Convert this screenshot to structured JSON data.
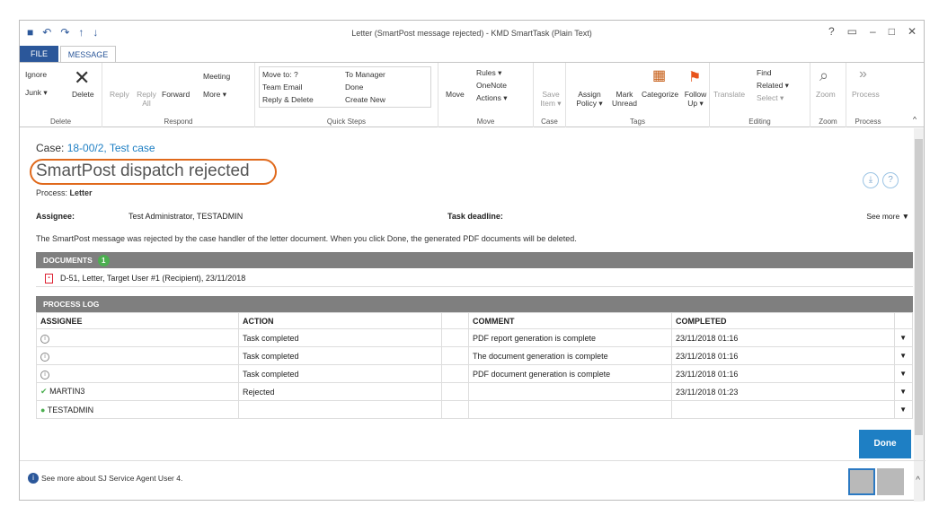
{
  "window": {
    "title": "Letter (SmartPost message rejected) - KMD SmartTask (Plain Text)",
    "controls": [
      "?",
      "▭",
      "–",
      "□",
      "✕"
    ]
  },
  "tabs": {
    "file": "FILE",
    "message": "MESSAGE"
  },
  "ribbon": {
    "delete": {
      "label": "Delete",
      "ignore": "Ignore",
      "junk": "Junk ▾",
      "delete_btn": "Delete"
    },
    "respond": {
      "label": "Respond",
      "reply": "Reply",
      "reply_all": "Reply All",
      "forward": "Forward",
      "meeting": "Meeting",
      "more": "More ▾"
    },
    "quick_steps": {
      "label": "Quick Steps",
      "move_to": "Move to: ?",
      "team_email": "Team Email",
      "reply_delete": "Reply & Delete",
      "to_manager": "To Manager",
      "done": "Done",
      "create_new": "Create New"
    },
    "move": {
      "label": "Move",
      "move_btn": "Move",
      "rules": "Rules ▾",
      "onenote": "OneNote",
      "actions": "Actions ▾"
    },
    "case": {
      "label": "Case",
      "save_item": "Save Item ▾"
    },
    "tags": {
      "label": "Tags",
      "assign_policy": "Assign Policy ▾",
      "mark_unread": "Mark Unread",
      "categorize": "Categorize",
      "follow_up": "Follow Up ▾"
    },
    "editing": {
      "label": "Editing",
      "translate": "Translate",
      "find": "Find",
      "related": "Related ▾",
      "select": "Select ▾"
    },
    "zoom": {
      "label": "Zoom",
      "zoom_btn": "Zoom"
    },
    "process": {
      "label": "Process",
      "process_btn": "Process"
    }
  },
  "case": {
    "prefix": "Case:",
    "id": "18-00/2, Test case"
  },
  "heading": "SmartPost dispatch rejected",
  "process": {
    "label": "Process:",
    "value": "Letter"
  },
  "assignee": {
    "label": "Assignee:",
    "value": "Test Administrator, TESTADMIN"
  },
  "deadline": {
    "label": "Task deadline:"
  },
  "see_more": "See more ▼",
  "description": "The SmartPost message was rejected by the case handler of the letter document. When you click Done, the generated PDF documents will be deleted.",
  "documents": {
    "header": "DOCUMENTS",
    "count": "1",
    "item": "D-51, Letter, Target User #1 (Recipient), 23/11/2018"
  },
  "process_log": {
    "header": "PROCESS LOG",
    "columns": [
      "ASSIGNEE",
      "ACTION",
      "COMMENT",
      "COMPLETED"
    ],
    "rows": [
      {
        "assignee": "",
        "action": "Task completed",
        "comment": "PDF report generation is complete",
        "completed": "23/11/2018 01:16"
      },
      {
        "assignee": "",
        "action": "Task completed",
        "comment": "The document generation is complete",
        "completed": "23/11/2018 01:16"
      },
      {
        "assignee": "",
        "action": "Task completed",
        "comment": "PDF document generation is complete",
        "completed": "23/11/2018 01:16"
      },
      {
        "assignee": "MARTIN3",
        "action": "Rejected",
        "comment": "",
        "completed": "23/11/2018 01:23"
      },
      {
        "assignee": "TESTADMIN",
        "action": "",
        "comment": "",
        "completed": ""
      }
    ]
  },
  "done_button": "Done",
  "footer": {
    "text": "See more about SJ Service Agent User 4."
  }
}
